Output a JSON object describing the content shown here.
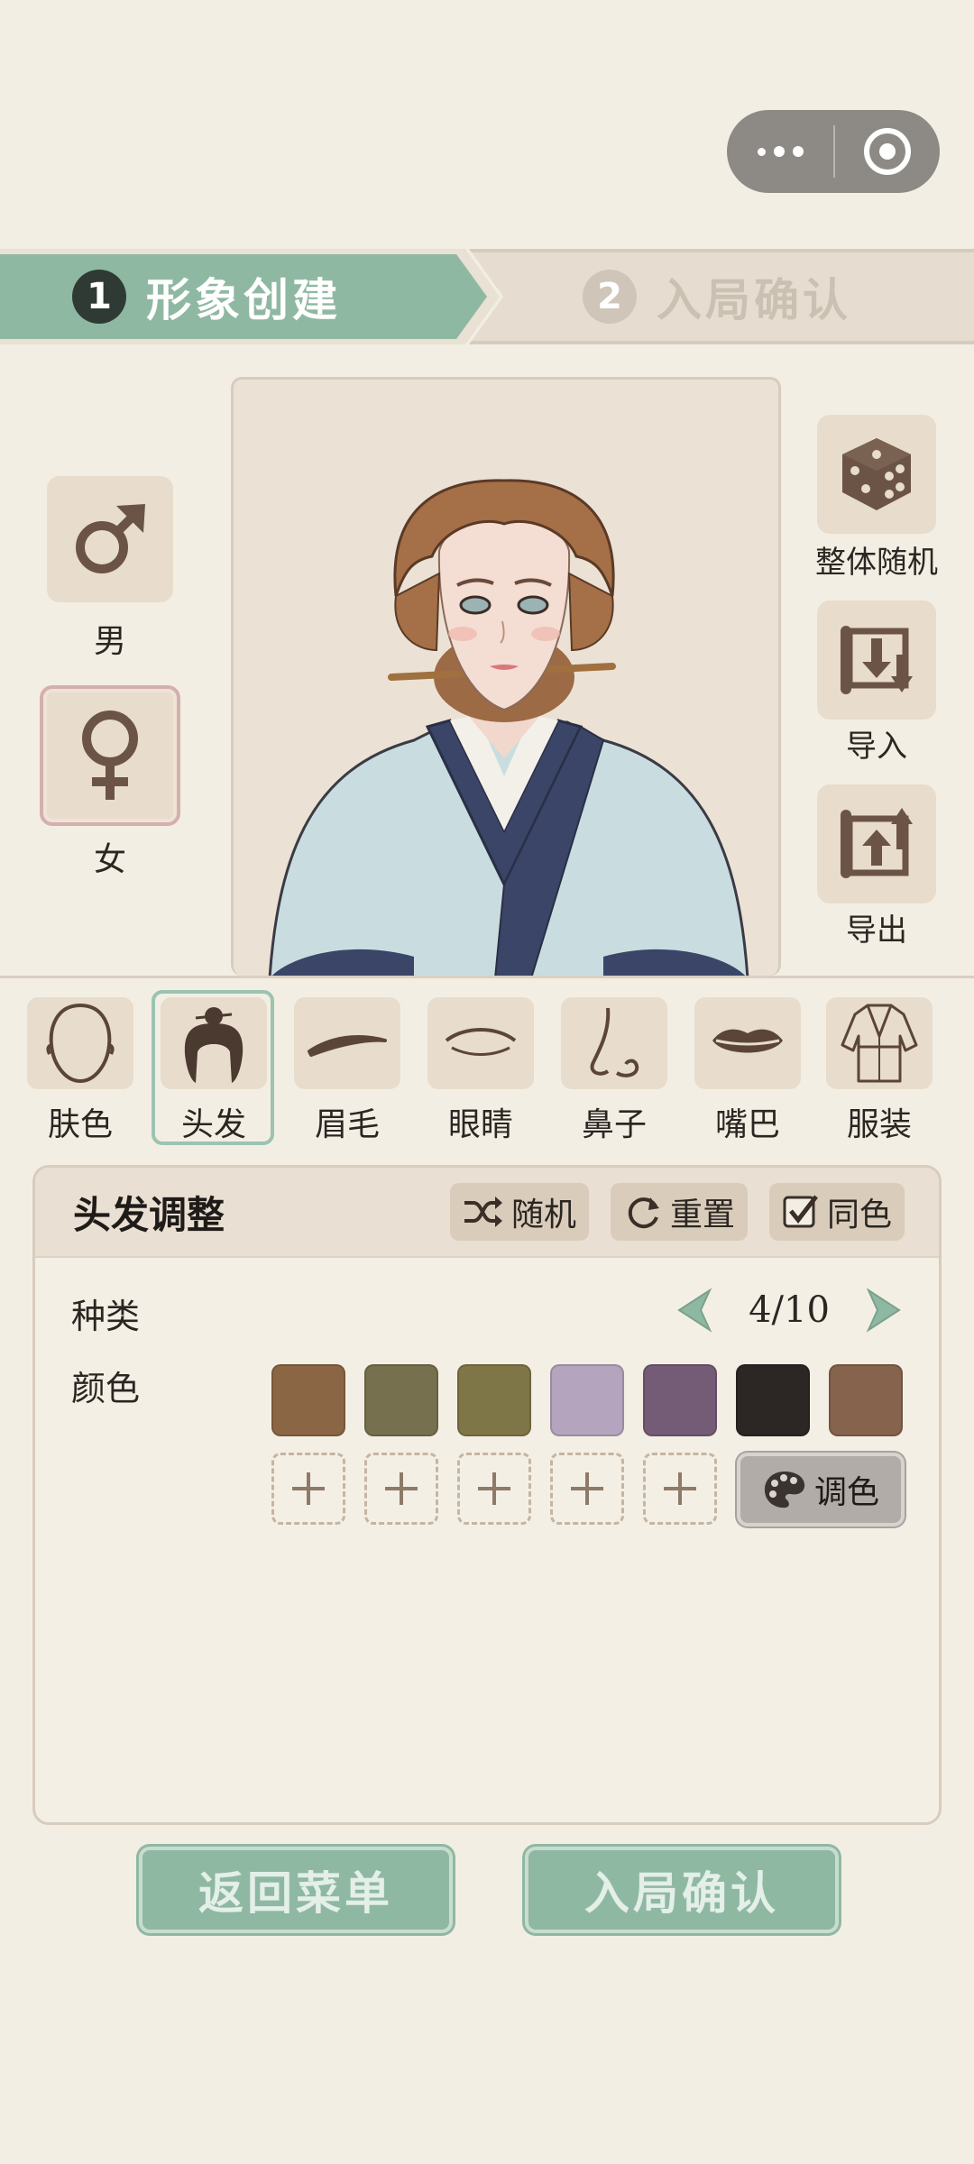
{
  "steps": [
    {
      "num": "1",
      "label": "形象创建",
      "state": "active"
    },
    {
      "num": "2",
      "label": "入局确认",
      "state": "inactive"
    }
  ],
  "gender": {
    "male_label": "男",
    "female_label": "女",
    "selected": "female"
  },
  "side_actions": {
    "random_all": "整体随机",
    "import": "导入",
    "export": "导出"
  },
  "tabs": [
    {
      "label": "肤色",
      "icon": "face-outline-icon"
    },
    {
      "label": "头发",
      "icon": "hair-bun-icon"
    },
    {
      "label": "眉毛",
      "icon": "eyebrow-icon"
    },
    {
      "label": "眼睛",
      "icon": "eye-icon"
    },
    {
      "label": "鼻子",
      "icon": "nose-icon"
    },
    {
      "label": "嘴巴",
      "icon": "lips-icon"
    },
    {
      "label": "服装",
      "icon": "robe-icon"
    }
  ],
  "selected_tab": "头发",
  "panel": {
    "title": "头发调整",
    "random_label": "随机",
    "reset_label": "重置",
    "same_color_label": "同色",
    "same_color_checked": true,
    "type_label": "种类",
    "type_value": "4/10",
    "color_label": "颜色",
    "swatches": [
      "#8b6645",
      "#77704f",
      "#7f7648",
      "#b4a4bd",
      "#745c77",
      "#2c2725",
      "#86634d"
    ],
    "palette_label": "调色"
  },
  "buttons": {
    "back_menu": "返回菜单",
    "confirm": "入局确认"
  },
  "colors": {
    "accent_green": "#8fb8a2",
    "panel_tan": "#e8dccc",
    "background": "#f3eee3"
  }
}
